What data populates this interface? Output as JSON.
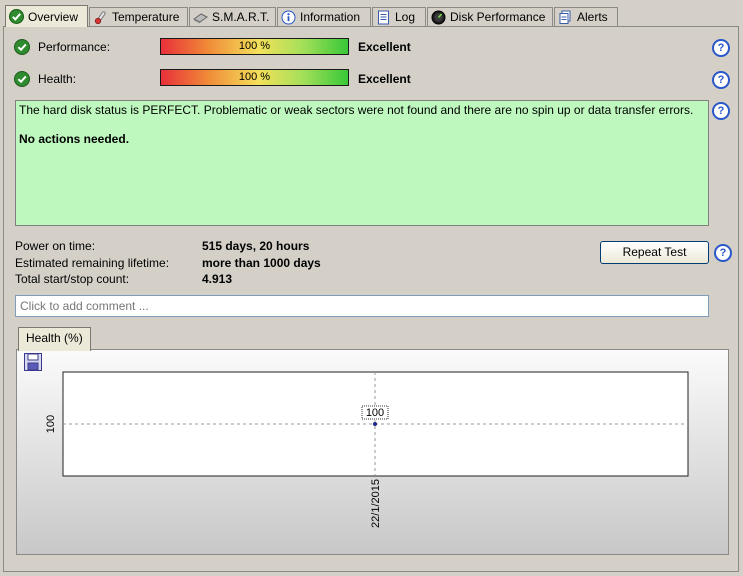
{
  "tabs": [
    {
      "label": "Overview",
      "icon": "check-circle-icon"
    },
    {
      "label": "Temperature",
      "icon": "thermometer-icon"
    },
    {
      "label": "S.M.A.R.T.",
      "icon": "smart-drive-icon"
    },
    {
      "label": "Information",
      "icon": "info-icon"
    },
    {
      "label": "Log",
      "icon": "log-document-icon"
    },
    {
      "label": "Disk Performance",
      "icon": "speedometer-icon"
    },
    {
      "label": "Alerts",
      "icon": "alerts-document-icon"
    }
  ],
  "performance": {
    "label": "Performance:",
    "percent": 100,
    "percent_text": "100 %",
    "rating": "Excellent"
  },
  "health": {
    "label": "Health:",
    "percent": 100,
    "percent_text": "100 %",
    "rating": "Excellent"
  },
  "status": {
    "message": "The hard disk status is PERFECT. Problematic or weak sectors were not found and there are no spin up or data transfer errors.",
    "action": "No actions needed.",
    "background": "#bff8bf"
  },
  "stats": {
    "power_on_label": "Power on time:",
    "power_on_value": "515 days, 20 hours",
    "lifetime_label": "Estimated remaining lifetime:",
    "lifetime_value": "more than 1000 days",
    "startstop_label": "Total start/stop count:",
    "startstop_value": "4.913"
  },
  "repeat_button": "Repeat Test",
  "help_glyph": "?",
  "comment": {
    "placeholder": "Click to add comment ..."
  },
  "chart_tab": "Health (%)",
  "chart_data": {
    "type": "scatter",
    "x": [
      "22/1/2015"
    ],
    "y": [
      100
    ],
    "point_labels": [
      "100"
    ],
    "y_ticks": [
      "100"
    ],
    "x_ticks": [
      "22/1/2015"
    ],
    "title": "",
    "xlabel": "",
    "ylabel": "",
    "grid": true
  }
}
